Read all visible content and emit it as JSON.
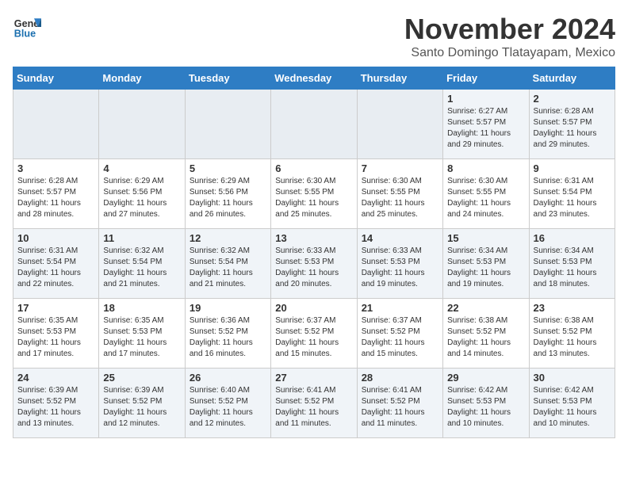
{
  "header": {
    "logo_general": "General",
    "logo_blue": "Blue",
    "month": "November 2024",
    "location": "Santo Domingo Tlatayapam, Mexico"
  },
  "days_of_week": [
    "Sunday",
    "Monday",
    "Tuesday",
    "Wednesday",
    "Thursday",
    "Friday",
    "Saturday"
  ],
  "weeks": [
    [
      {
        "day": "",
        "info": ""
      },
      {
        "day": "",
        "info": ""
      },
      {
        "day": "",
        "info": ""
      },
      {
        "day": "",
        "info": ""
      },
      {
        "day": "",
        "info": ""
      },
      {
        "day": "1",
        "info": "Sunrise: 6:27 AM\nSunset: 5:57 PM\nDaylight: 11 hours\nand 29 minutes."
      },
      {
        "day": "2",
        "info": "Sunrise: 6:28 AM\nSunset: 5:57 PM\nDaylight: 11 hours\nand 29 minutes."
      }
    ],
    [
      {
        "day": "3",
        "info": "Sunrise: 6:28 AM\nSunset: 5:57 PM\nDaylight: 11 hours\nand 28 minutes."
      },
      {
        "day": "4",
        "info": "Sunrise: 6:29 AM\nSunset: 5:56 PM\nDaylight: 11 hours\nand 27 minutes."
      },
      {
        "day": "5",
        "info": "Sunrise: 6:29 AM\nSunset: 5:56 PM\nDaylight: 11 hours\nand 26 minutes."
      },
      {
        "day": "6",
        "info": "Sunrise: 6:30 AM\nSunset: 5:55 PM\nDaylight: 11 hours\nand 25 minutes."
      },
      {
        "day": "7",
        "info": "Sunrise: 6:30 AM\nSunset: 5:55 PM\nDaylight: 11 hours\nand 25 minutes."
      },
      {
        "day": "8",
        "info": "Sunrise: 6:30 AM\nSunset: 5:55 PM\nDaylight: 11 hours\nand 24 minutes."
      },
      {
        "day": "9",
        "info": "Sunrise: 6:31 AM\nSunset: 5:54 PM\nDaylight: 11 hours\nand 23 minutes."
      }
    ],
    [
      {
        "day": "10",
        "info": "Sunrise: 6:31 AM\nSunset: 5:54 PM\nDaylight: 11 hours\nand 22 minutes."
      },
      {
        "day": "11",
        "info": "Sunrise: 6:32 AM\nSunset: 5:54 PM\nDaylight: 11 hours\nand 21 minutes."
      },
      {
        "day": "12",
        "info": "Sunrise: 6:32 AM\nSunset: 5:54 PM\nDaylight: 11 hours\nand 21 minutes."
      },
      {
        "day": "13",
        "info": "Sunrise: 6:33 AM\nSunset: 5:53 PM\nDaylight: 11 hours\nand 20 minutes."
      },
      {
        "day": "14",
        "info": "Sunrise: 6:33 AM\nSunset: 5:53 PM\nDaylight: 11 hours\nand 19 minutes."
      },
      {
        "day": "15",
        "info": "Sunrise: 6:34 AM\nSunset: 5:53 PM\nDaylight: 11 hours\nand 19 minutes."
      },
      {
        "day": "16",
        "info": "Sunrise: 6:34 AM\nSunset: 5:53 PM\nDaylight: 11 hours\nand 18 minutes."
      }
    ],
    [
      {
        "day": "17",
        "info": "Sunrise: 6:35 AM\nSunset: 5:53 PM\nDaylight: 11 hours\nand 17 minutes."
      },
      {
        "day": "18",
        "info": "Sunrise: 6:35 AM\nSunset: 5:53 PM\nDaylight: 11 hours\nand 17 minutes."
      },
      {
        "day": "19",
        "info": "Sunrise: 6:36 AM\nSunset: 5:52 PM\nDaylight: 11 hours\nand 16 minutes."
      },
      {
        "day": "20",
        "info": "Sunrise: 6:37 AM\nSunset: 5:52 PM\nDaylight: 11 hours\nand 15 minutes."
      },
      {
        "day": "21",
        "info": "Sunrise: 6:37 AM\nSunset: 5:52 PM\nDaylight: 11 hours\nand 15 minutes."
      },
      {
        "day": "22",
        "info": "Sunrise: 6:38 AM\nSunset: 5:52 PM\nDaylight: 11 hours\nand 14 minutes."
      },
      {
        "day": "23",
        "info": "Sunrise: 6:38 AM\nSunset: 5:52 PM\nDaylight: 11 hours\nand 13 minutes."
      }
    ],
    [
      {
        "day": "24",
        "info": "Sunrise: 6:39 AM\nSunset: 5:52 PM\nDaylight: 11 hours\nand 13 minutes."
      },
      {
        "day": "25",
        "info": "Sunrise: 6:39 AM\nSunset: 5:52 PM\nDaylight: 11 hours\nand 12 minutes."
      },
      {
        "day": "26",
        "info": "Sunrise: 6:40 AM\nSunset: 5:52 PM\nDaylight: 11 hours\nand 12 minutes."
      },
      {
        "day": "27",
        "info": "Sunrise: 6:41 AM\nSunset: 5:52 PM\nDaylight: 11 hours\nand 11 minutes."
      },
      {
        "day": "28",
        "info": "Sunrise: 6:41 AM\nSunset: 5:52 PM\nDaylight: 11 hours\nand 11 minutes."
      },
      {
        "day": "29",
        "info": "Sunrise: 6:42 AM\nSunset: 5:53 PM\nDaylight: 11 hours\nand 10 minutes."
      },
      {
        "day": "30",
        "info": "Sunrise: 6:42 AM\nSunset: 5:53 PM\nDaylight: 11 hours\nand 10 minutes."
      }
    ]
  ]
}
